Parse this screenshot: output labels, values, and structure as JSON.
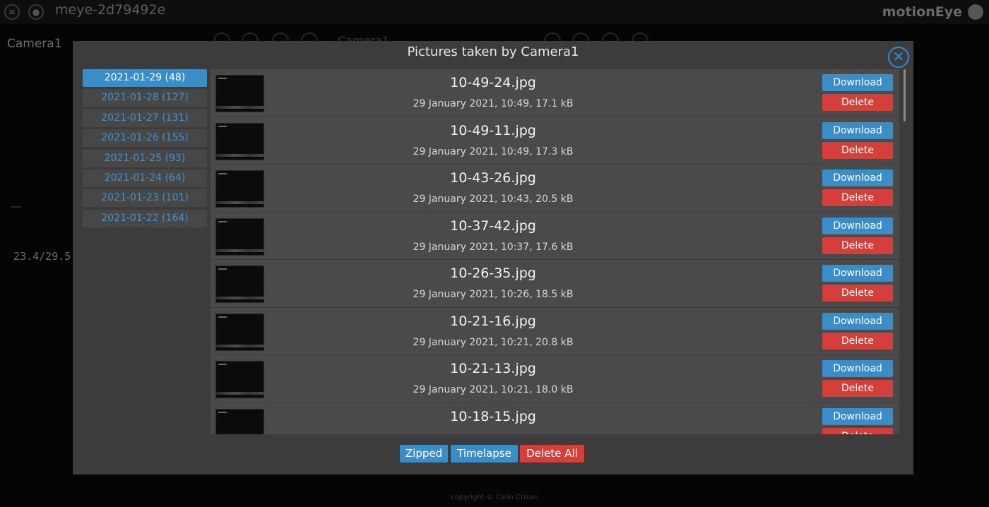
{
  "header": {
    "device_name": "meye-2d79492e",
    "brand": "motionEye",
    "menu_icon": "menu-icon",
    "user_icon": "user-icon",
    "logo_icon": "motioneye-logo-icon"
  },
  "background": {
    "camera_title": "Camera1",
    "ghost_title": "Camera1",
    "sensor_reading": "23.4/29.5"
  },
  "modal": {
    "title": "Pictures taken by Camera1",
    "close_icon": "close-icon",
    "dates": [
      {
        "label": "2021-01-29 (48)",
        "active": true
      },
      {
        "label": "2021-01-28 (127)",
        "active": false
      },
      {
        "label": "2021-01-27 (131)",
        "active": false
      },
      {
        "label": "2021-01-26 (155)",
        "active": false
      },
      {
        "label": "2021-01-25 (93)",
        "active": false
      },
      {
        "label": "2021-01-24 (64)",
        "active": false
      },
      {
        "label": "2021-01-23 (101)",
        "active": false
      },
      {
        "label": "2021-01-22 (164)",
        "active": false
      }
    ],
    "pictures": [
      {
        "name": "10-49-24.jpg",
        "info": "29 January 2021, 10:49, 17.1 kB"
      },
      {
        "name": "10-49-11.jpg",
        "info": "29 January 2021, 10:49, 17.3 kB"
      },
      {
        "name": "10-43-26.jpg",
        "info": "29 January 2021, 10:43, 20.5 kB"
      },
      {
        "name": "10-37-42.jpg",
        "info": "29 January 2021, 10:37, 17.6 kB"
      },
      {
        "name": "10-26-35.jpg",
        "info": "29 January 2021, 10:26, 18.5 kB"
      },
      {
        "name": "10-21-16.jpg",
        "info": "29 January 2021, 10:21, 20.8 kB"
      },
      {
        "name": "10-21-13.jpg",
        "info": "29 January 2021, 10:21, 18.0 kB"
      },
      {
        "name": "10-18-15.jpg",
        "info": ""
      }
    ],
    "download_label": "Download",
    "delete_label": "Delete",
    "footer": {
      "zipped_label": "Zipped",
      "timelapse_label": "Timelapse",
      "delete_all_label": "Delete All"
    }
  },
  "colors": {
    "primary": "#3b8dc8",
    "danger": "#d43f3a",
    "modal_bg": "#3c3c3c",
    "row_bg": "#4a4a4a"
  }
}
